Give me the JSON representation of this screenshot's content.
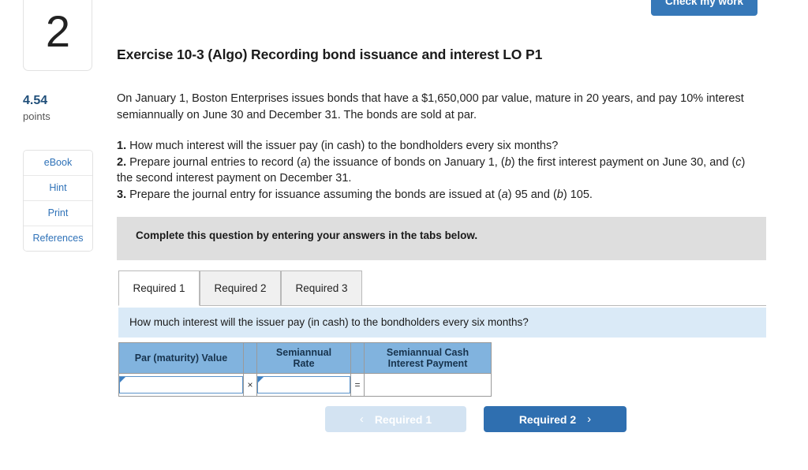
{
  "sidebar": {
    "question_number": "2",
    "points_value": "4.54",
    "points_label": "points",
    "buttons": [
      {
        "label": "eBook",
        "name": "ebook"
      },
      {
        "label": "Hint",
        "name": "hint"
      },
      {
        "label": "Print",
        "name": "print"
      },
      {
        "label": "References",
        "name": "references"
      }
    ]
  },
  "toolbar": {
    "check_my_work_label": "Check my work"
  },
  "exercise": {
    "title": "Exercise 10-3 (Algo) Recording bond issuance and interest LO P1",
    "intro": "On January 1, Boston Enterprises issues bonds that have a $1,650,000 par value, mature in 20 years, and pay 10% interest semiannually on June 30 and December 31. The bonds are sold at par.",
    "requirements": [
      {
        "num": "1.",
        "text": "How much interest will the issuer pay (in cash) to the bondholders every six months?"
      },
      {
        "num": "2.",
        "pre": "Prepare journal entries to record (",
        "a": "a",
        "mid1": ") the issuance of bonds on January 1, (",
        "b": "b",
        "mid2": ") the first interest payment on June 30, and (",
        "c": "c",
        "post": ") the second interest payment on December 31."
      },
      {
        "num": "3.",
        "pre": "Prepare the journal entry for issuance assuming the bonds are issued at (",
        "a": "a",
        "mid1": ") 95 and (",
        "b": "b",
        "post": ") 105."
      }
    ]
  },
  "banner": {
    "text": "Complete this question by entering your answers in the tabs below."
  },
  "tabs": [
    {
      "label": "Required 1",
      "active": true
    },
    {
      "label": "Required 2",
      "active": false
    },
    {
      "label": "Required 3",
      "active": false
    }
  ],
  "prompt": {
    "text": "How much interest will the issuer pay (in cash) to the bondholders every six months?"
  },
  "answer_table": {
    "headers": [
      "Par (maturity) Value",
      "",
      "Semiannual Rate",
      "",
      "Semiannual Cash Interest Payment"
    ],
    "header_par": "Par (maturity) Value",
    "header_rate_line1": "Semiannual",
    "header_rate_line2": "Rate",
    "header_payment_line1": "Semiannual Cash",
    "header_payment_line2": "Interest Payment",
    "operator_multiply": "×",
    "operator_equals": "=",
    "row": {
      "par_value": "",
      "rate": "",
      "payment": ""
    }
  },
  "nav": {
    "prev_label": "Required 1",
    "prev_chevron": "‹",
    "next_label": "Required 2",
    "next_chevron": "›"
  },
  "colors": {
    "accent_blue": "#2f6fb0",
    "header_blue": "#81b3de",
    "prompt_blue": "#daeaf7",
    "banner_grey": "#dedede",
    "link_blue": "#2f72b8"
  }
}
